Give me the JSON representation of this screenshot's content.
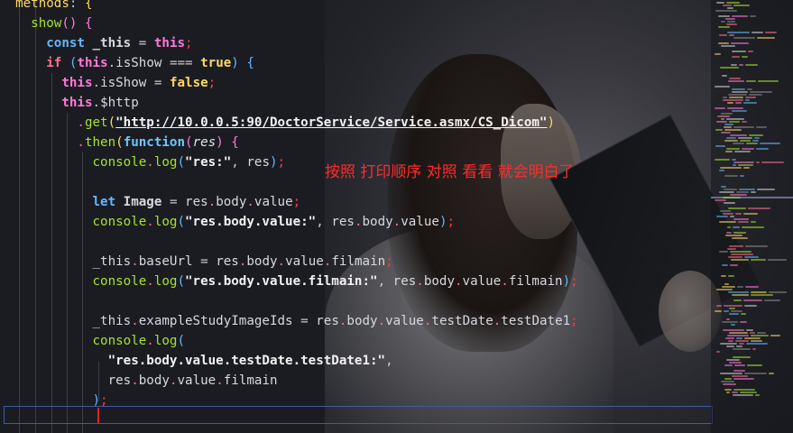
{
  "annotation": "按照 打印顺序 对照 看看 就会明白了",
  "colors": {
    "background": "#1b1c22",
    "keyword": "#62b8ff",
    "control": "#ff6e8e",
    "this": "#ff79d8",
    "method": "#a6e22e",
    "property": "#ffd866",
    "annotation": "#ff2b2b",
    "current_line_border": "#3e5ba8"
  },
  "code": {
    "l1": {
      "methods": "methods",
      "colon": ":",
      "brace": "{"
    },
    "l2": {
      "show": "show",
      "parens": "()",
      "brace": "{"
    },
    "l3": {
      "const": "const",
      "name": "_this",
      "eq": "=",
      "this": "this",
      "semi": ";"
    },
    "l4": {
      "if": "if",
      "paren_open": "(",
      "this": "this",
      "prop": "isShow",
      "op": "===",
      "val": "true",
      "paren_close": ")",
      "brace": "{"
    },
    "l5": {
      "this": "this",
      "prop": "isShow",
      "eq": "=",
      "val": "false",
      "semi": ";"
    },
    "l6": {
      "this": "this",
      "prop": "$http"
    },
    "l7": {
      "method": "get",
      "paren_open": "(",
      "url": "\"http://10.0.0.5:90/DoctorService/Service.asmx/CS_Dicom\"",
      "paren_close": ")"
    },
    "l8": {
      "method": "then",
      "paren_open": "(",
      "fn": "function",
      "pparen": "(",
      "param": "res",
      "pclose": ")",
      "brace": "{"
    },
    "l9": {
      "console": "console",
      "log": "log",
      "paren_open": "(",
      "str": "\"res:\"",
      "comma": ",",
      "arg": "res",
      "paren_close": ")",
      "semi": ";"
    },
    "l11": {
      "let": "let",
      "name": "Image",
      "eq": "=",
      "res": "res",
      "body": "body",
      "value": "value",
      "semi": ";"
    },
    "l12": {
      "console": "console",
      "log": "log",
      "paren_open": "(",
      "str": "\"res.body.value:\"",
      "comma": ",",
      "res": "res",
      "body": "body",
      "value": "value",
      "paren_close": ")",
      "semi": ";"
    },
    "l14": {
      "this": "_this",
      "prop": "baseUrl",
      "eq": "=",
      "res": "res",
      "body": "body",
      "value": "value",
      "filmain": "filmain",
      "semi": ";"
    },
    "l15": {
      "console": "console",
      "log": "log",
      "paren_open": "(",
      "str": "\"res.body.value.filmain:\"",
      "comma": ",",
      "res": "res",
      "body": "body",
      "value": "value",
      "filmain": "filmain",
      "paren_close": ")",
      "semi": ";"
    },
    "l17": {
      "this": "_this",
      "prop": "exampleStudyImageIds",
      "eq": "=",
      "res": "res",
      "body": "body",
      "value": "value",
      "testDate": "testDate",
      "testDate1": "testDate1",
      "semi": ";"
    },
    "l18": {
      "console": "console",
      "log": "log",
      "paren_open": "("
    },
    "l19": {
      "str": "\"res.body.value.testDate.testDate1:\"",
      "comma": ","
    },
    "l20": {
      "res": "res",
      "body": "body",
      "value": "value",
      "filmain": "filmain"
    },
    "l21": {
      "paren_close": ")",
      "semi": ";"
    }
  }
}
